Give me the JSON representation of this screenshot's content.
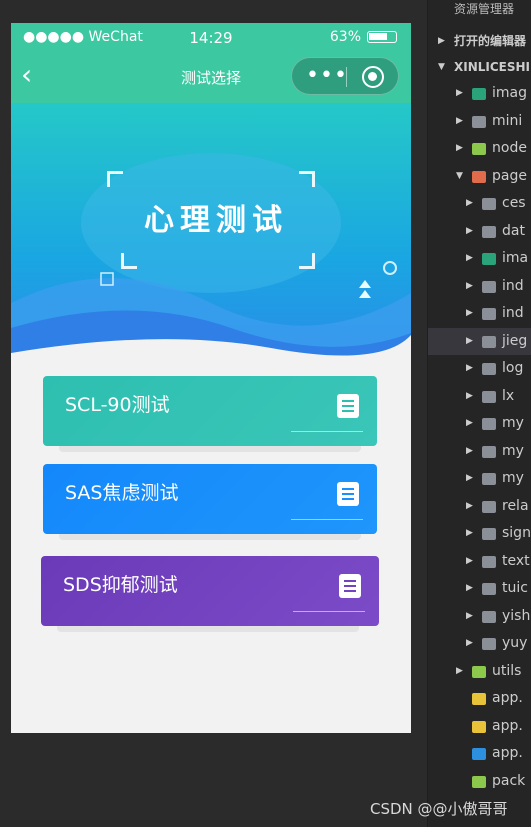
{
  "status_bar": {
    "carrier": "●●●●● WeChat",
    "wifi_icon": "wifi-icon",
    "time": "14:29",
    "battery": "63%"
  },
  "nav": {
    "back_glyph": "‹",
    "title": "测试选择",
    "more_glyph": "•••"
  },
  "banner": {
    "title": "心理测试"
  },
  "cards": [
    {
      "label": "SCL-90测试",
      "color": "#2ebfb0"
    },
    {
      "label": "SAS焦虑测试",
      "color": "#1990fb"
    },
    {
      "label": "SDS抑郁测试",
      "color": "#7244c0"
    }
  ],
  "explorer": {
    "header": "资源管理器",
    "open_editors": "打开的编辑器",
    "project": "XINLICESHI",
    "items": [
      {
        "label": "imag",
        "icon": "image-folder-icon",
        "color": "#2aa37a",
        "indent": 1
      },
      {
        "label": "mini",
        "icon": "folder-icon",
        "color": "#8a8f98",
        "indent": 1
      },
      {
        "label": "node",
        "icon": "node-folder-icon",
        "color": "#8cc84b",
        "indent": 1
      },
      {
        "label": "page",
        "icon": "pages-folder-icon",
        "color": "#e06c4b",
        "indent": 1
      },
      {
        "label": "ces",
        "icon": "folder-icon",
        "color": "#8a8f98",
        "indent": 2
      },
      {
        "label": "dat",
        "icon": "folder-icon",
        "color": "#8a8f98",
        "indent": 2
      },
      {
        "label": "ima",
        "icon": "image-folder-icon",
        "color": "#2aa37a",
        "indent": 2
      },
      {
        "label": "ind",
        "icon": "folder-icon",
        "color": "#8a8f98",
        "indent": 2
      },
      {
        "label": "ind",
        "icon": "folder-icon",
        "color": "#8a8f98",
        "indent": 2
      },
      {
        "label": "jieg",
        "icon": "folder-icon",
        "color": "#8a8f98",
        "indent": 2
      },
      {
        "label": "log",
        "icon": "folder-icon",
        "color": "#8a8f98",
        "indent": 2
      },
      {
        "label": "lx",
        "icon": "folder-icon",
        "color": "#8a8f98",
        "indent": 2
      },
      {
        "label": "my",
        "icon": "folder-icon",
        "color": "#8a8f98",
        "indent": 2
      },
      {
        "label": "my",
        "icon": "folder-icon",
        "color": "#8a8f98",
        "indent": 2
      },
      {
        "label": "my",
        "icon": "folder-icon",
        "color": "#8a8f98",
        "indent": 2
      },
      {
        "label": "rela",
        "icon": "folder-icon",
        "color": "#8a8f98",
        "indent": 2
      },
      {
        "label": "sign",
        "icon": "folder-icon",
        "color": "#8a8f98",
        "indent": 2
      },
      {
        "label": "text",
        "icon": "folder-icon",
        "color": "#8a8f98",
        "indent": 2
      },
      {
        "label": "tuic",
        "icon": "folder-icon",
        "color": "#8a8f98",
        "indent": 2
      },
      {
        "label": "yish",
        "icon": "folder-icon",
        "color": "#8a8f98",
        "indent": 2
      },
      {
        "label": "yuy",
        "icon": "folder-icon",
        "color": "#8a8f98",
        "indent": 2
      },
      {
        "label": "utils",
        "icon": "utils-folder-icon",
        "color": "#8cc84b",
        "indent": 1
      },
      {
        "label": "app.",
        "icon": "js-file-icon",
        "color": "#e8c33a",
        "indent": 1
      },
      {
        "label": "app.",
        "icon": "json-file-icon",
        "color": "#e8c33a",
        "indent": 1
      },
      {
        "label": "app.",
        "icon": "css-file-icon",
        "color": "#2d8fe0",
        "indent": 1
      },
      {
        "label": "pack",
        "icon": "node-file-icon",
        "color": "#8cc84b",
        "indent": 1
      }
    ]
  },
  "watermark": "CSDN @@小傲哥哥"
}
